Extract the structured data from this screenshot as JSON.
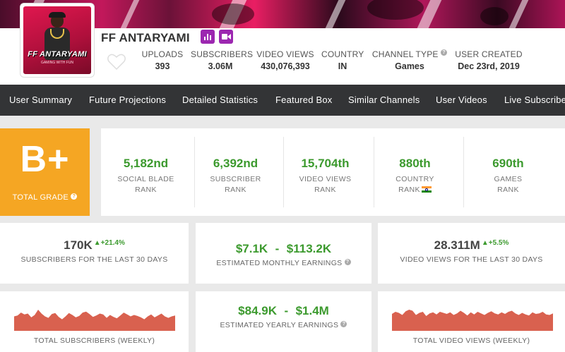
{
  "channel": {
    "name": "FF ANTARYAMI",
    "avatar_text": "FF ANTARYAMI",
    "avatar_subtext": "GAMING WITH FUN"
  },
  "header_stats": [
    {
      "label": "UPLOADS",
      "value": "393"
    },
    {
      "label": "SUBSCRIBERS",
      "value": "3.06M"
    },
    {
      "label": "VIDEO VIEWS",
      "value": "430,076,393"
    },
    {
      "label": "COUNTRY",
      "value": "IN"
    },
    {
      "label": "CHANNEL TYPE",
      "value": "Games"
    },
    {
      "label": "USER CREATED",
      "value": "Dec 23rd, 2019"
    }
  ],
  "nav": [
    "User Summary",
    "Future Projections",
    "Detailed Statistics",
    "Featured Box",
    "Similar Channels",
    "User Videos",
    "Live Subscriber"
  ],
  "grade": {
    "value": "B+",
    "label": "TOTAL GRADE"
  },
  "ranks": [
    {
      "value": "5,182nd",
      "line1": "SOCIAL BLADE",
      "line2": "RANK"
    },
    {
      "value": "6,392nd",
      "line1": "SUBSCRIBER",
      "line2": "RANK"
    },
    {
      "value": "15,704th",
      "line1": "VIDEO VIEWS",
      "line2": "RANK"
    },
    {
      "value": "880th",
      "line1": "COUNTRY",
      "line2": "RANK"
    },
    {
      "value": "690th",
      "line1": "GAMES",
      "line2": "RANK"
    }
  ],
  "cards": {
    "subs_30": {
      "value": "170K",
      "delta": "+21.4%",
      "label": "SUBSCRIBERS FOR THE LAST 30 DAYS"
    },
    "monthly": {
      "low": "$7.1K",
      "sep": "-",
      "high": "$113.2K",
      "label": "ESTIMATED MONTHLY EARNINGS"
    },
    "views_30": {
      "value": "28.311M",
      "delta": "+5.5%",
      "label": "VIDEO VIEWS FOR THE LAST 30 DAYS"
    },
    "weekly_subs": {
      "label": "TOTAL SUBSCRIBERS (WEEKLY)"
    },
    "yearly": {
      "low": "$84.9K",
      "sep": "-",
      "high": "$1.4M",
      "label": "ESTIMATED YEARLY EARNINGS"
    },
    "weekly_views": {
      "label": "TOTAL VIDEO VIEWS (WEEKLY)"
    }
  },
  "colors": {
    "grade_bg": "#f5a623",
    "rank_green": "#3c9a2e",
    "nav_bg": "#333436",
    "badge_purple": "#9c27b0",
    "spark_fill": "#d9614f"
  },
  "icons": [
    "chart-badge-icon",
    "video-badge-icon",
    "heart-icon",
    "help-icon",
    "india-flag-icon",
    "up-arrow-icon"
  ],
  "sparklines": {
    "weekly_subs": [
      30,
      32,
      38,
      34,
      36,
      28,
      33,
      44,
      36,
      30,
      27,
      35,
      37,
      29,
      24,
      30,
      37,
      33,
      28,
      31,
      38,
      40,
      35,
      29,
      32,
      36,
      34,
      27,
      33,
      29,
      26,
      32,
      38,
      34,
      30,
      33,
      31,
      28,
      24,
      30,
      34,
      28,
      32,
      36,
      30,
      27,
      30,
      32
    ],
    "weekly_views": [
      32,
      36,
      34,
      30,
      37,
      40,
      38,
      30,
      34,
      36,
      28,
      33,
      35,
      31,
      36,
      34,
      32,
      35,
      30,
      33,
      38,
      34,
      29,
      35,
      31,
      36,
      33,
      30,
      34,
      37,
      33,
      31,
      35,
      32,
      36,
      38,
      33,
      30,
      34,
      31,
      29,
      35,
      32,
      33,
      36,
      31,
      30,
      33
    ]
  }
}
